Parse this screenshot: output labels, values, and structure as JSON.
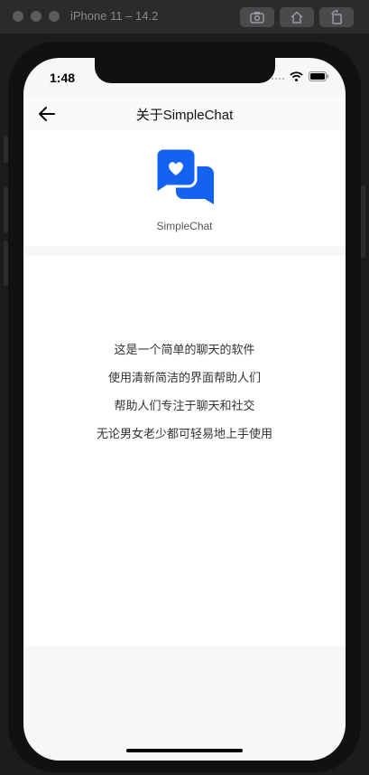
{
  "simulator": {
    "title": "iPhone 11 – 14.2"
  },
  "status_bar": {
    "time": "1:48"
  },
  "header": {
    "title": "关于SimpleChat"
  },
  "about": {
    "app_name": "SimpleChat"
  },
  "description": {
    "lines": [
      "这是一个简单的聊天的软件",
      "使用清新简洁的界面帮助人们",
      "帮助人们专注于聊天和社交",
      "无论男女老少都可轻易地上手使用"
    ]
  },
  "colors": {
    "accent": "#1463f0",
    "background": "#f7f7f7",
    "panel": "#ffffff"
  }
}
